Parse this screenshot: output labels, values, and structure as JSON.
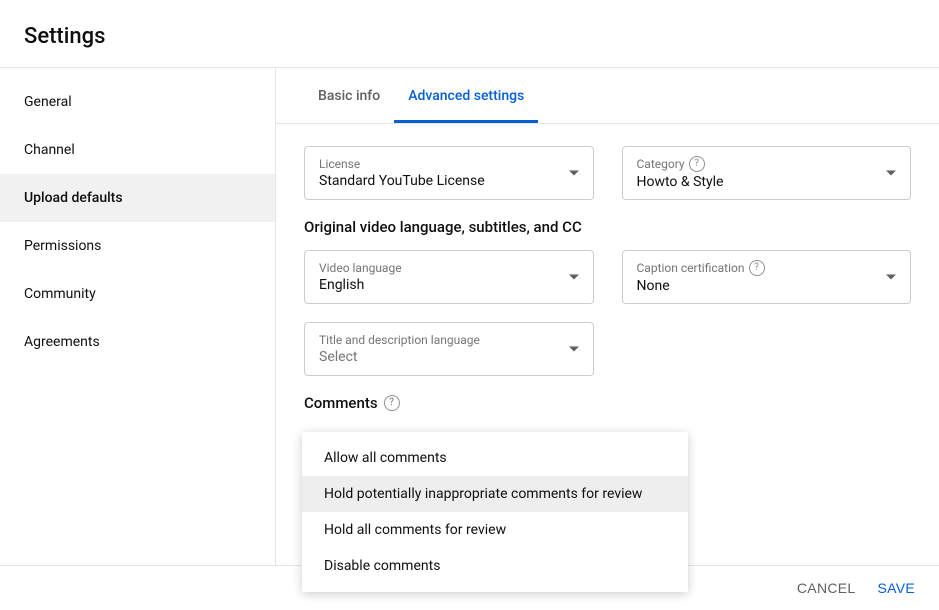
{
  "page_title": "Settings",
  "sidebar": {
    "items": [
      {
        "label": "General"
      },
      {
        "label": "Channel"
      },
      {
        "label": "Upload defaults"
      },
      {
        "label": "Permissions"
      },
      {
        "label": "Community"
      },
      {
        "label": "Agreements"
      }
    ]
  },
  "tabs": [
    {
      "label": "Basic info"
    },
    {
      "label": "Advanced settings"
    }
  ],
  "fields": {
    "license": {
      "label": "License",
      "value": "Standard YouTube License"
    },
    "category": {
      "label": "Category",
      "value": "Howto & Style"
    },
    "video_language": {
      "label": "Video language",
      "value": "English"
    },
    "caption_cert": {
      "label": "Caption certification",
      "value": "None"
    },
    "title_desc_lang": {
      "label": "Title and description language",
      "value": "Select"
    }
  },
  "sections": {
    "language": "Original video language, subtitles, and CC",
    "comments": "Comments"
  },
  "comments_options": [
    "Allow all comments",
    "Hold potentially inappropriate comments for review",
    "Hold all comments for review",
    "Disable comments"
  ],
  "footer": {
    "cancel": "CANCEL",
    "save": "SAVE"
  }
}
